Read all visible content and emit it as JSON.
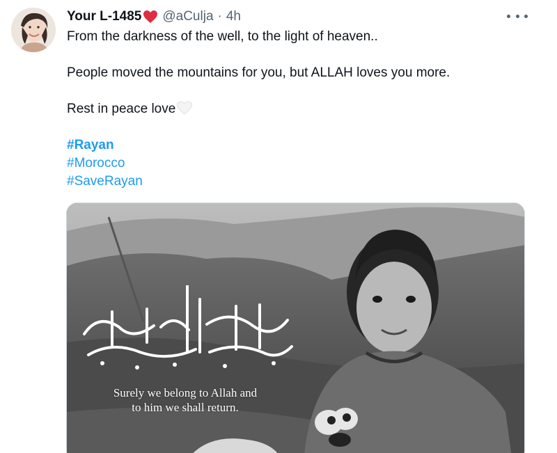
{
  "tweet": {
    "display_name": "Your L-1485",
    "handle": "@aCulja",
    "separator": "·",
    "time": "4h",
    "text": {
      "line1": "From the darkness of the well, to the light of heaven..",
      "line2": "People moved the mountains for you, but ALLAH loves you more.",
      "line3": "Rest in peace love"
    },
    "hashtags": [
      "#Rayan",
      "#Morocco",
      "#SaveRayan"
    ],
    "media": {
      "arabic_text": "إنا لله وإنا إليه راجعون",
      "caption_line1": "Surely we belong to Allah and",
      "caption_line2": "to him we shall return."
    }
  },
  "icons": {
    "red_heart": "red-heart-icon",
    "white_heart": "white-heart-icon",
    "more": "more-icon"
  },
  "colors": {
    "link": "#1d9bf0",
    "secondary_text": "#536471",
    "primary_text": "#0f1419",
    "heart_red": "#e0245e"
  }
}
